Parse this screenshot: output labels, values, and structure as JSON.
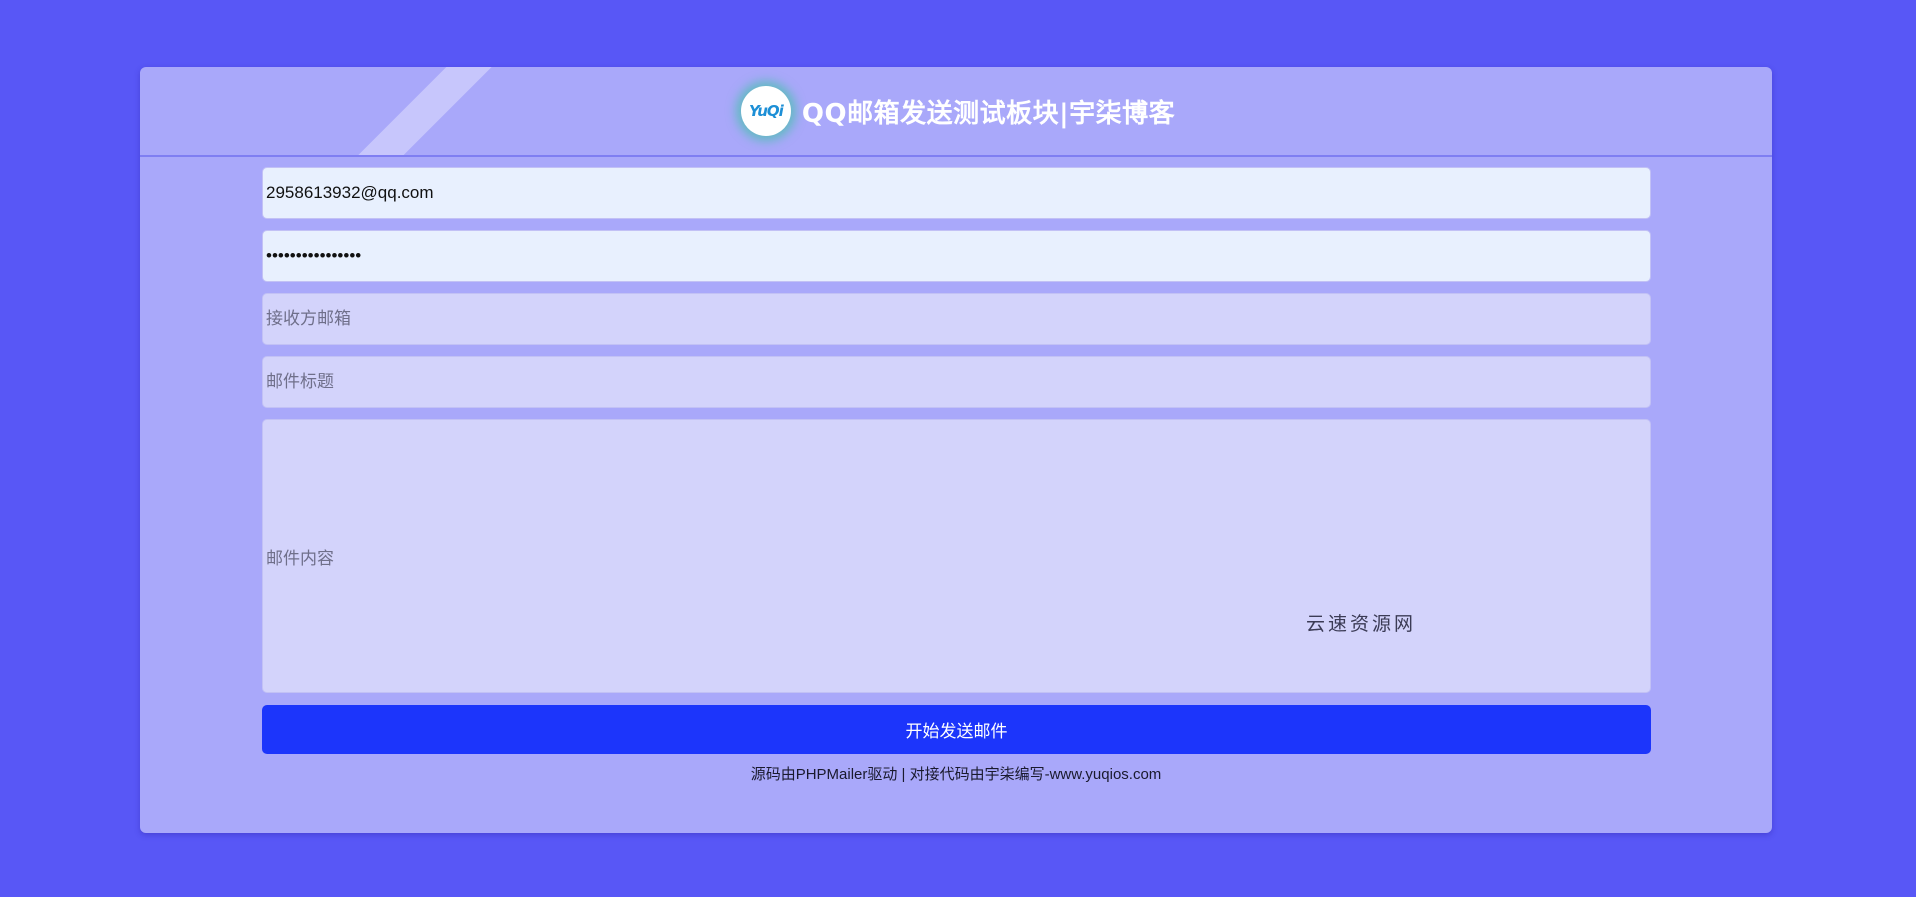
{
  "header": {
    "logo_text": "YuQi",
    "title": "QQ邮箱发送测试板块|宇柒博客"
  },
  "form": {
    "sender_email_value": "2958613932@qq.com",
    "password_value": "••••••••••••••••",
    "recipient_placeholder": "接收方邮箱",
    "subject_placeholder": "邮件标题",
    "content_placeholder": "邮件内容",
    "submit_label": "开始发送邮件"
  },
  "watermark": "云速资源网",
  "footer": {
    "text": "源码由PHPMailer驱动 | 对接代码由宇柒编写-www.yuqios.com"
  },
  "colors": {
    "page_background": "#5857f6",
    "card_background": "#a9a8fa",
    "button_background": "#1c35fb"
  }
}
